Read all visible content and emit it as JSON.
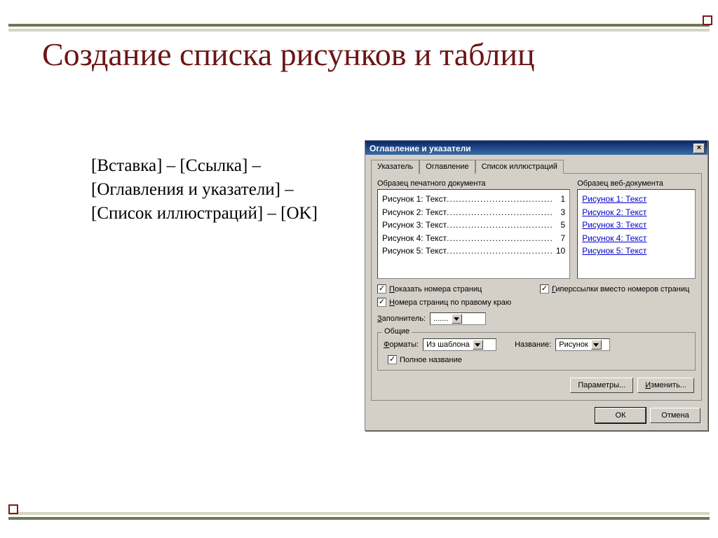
{
  "slide": {
    "title": "Создание списка рисунков и таблиц",
    "instructions": "[Вставка] – [Ссылка] – [Оглавления и указатели] – [Список иллюстраций] – [OK]"
  },
  "dialog": {
    "title": "Оглавление и указатели",
    "close": "×",
    "tabs": {
      "index": "Указатель",
      "toc": "Оглавление",
      "figures": "Список иллюстраций"
    },
    "printPreviewLabel": "Образец печатного документа",
    "webPreviewLabel": "Образец веб-документа",
    "printItems": [
      {
        "label": "Рисунок 1: Текст",
        "page": "1"
      },
      {
        "label": "Рисунок 2: Текст",
        "page": "3"
      },
      {
        "label": "Рисунок 3: Текст",
        "page": "5"
      },
      {
        "label": "Рисунок 4: Текст",
        "page": "7"
      },
      {
        "label": "Рисунок 5: Текст",
        "page": "10"
      }
    ],
    "webItems": [
      "Рисунок 1: Текст",
      "Рисунок 2: Текст",
      "Рисунок 3: Текст",
      "Рисунок 4: Текст",
      "Рисунок 5: Текст"
    ],
    "chkShowPages_pre": "П",
    "chkShowPages_rest": "оказать номера страниц",
    "chkRightAlign_pre": "Н",
    "chkRightAlign_rest": "омера страниц по правому краю",
    "chkHyperlinks_pre": "Г",
    "chkHyperlinks_rest": "иперссылки вместо номеров страниц",
    "leaderLabel_pre": "З",
    "leaderLabel_rest": "аполнитель:",
    "leaderValue": ".......",
    "groupGeneral": "Общие",
    "formatsLabel_pre": "Ф",
    "formatsLabel_rest": "орматы:",
    "formatsValue": "Из шаблона",
    "captionLabel": "Название:",
    "captionValue": "Рисунок",
    "fullCaption": "Полное название",
    "btnOptions": "Параметры...",
    "btnModify_pre": "И",
    "btnModify_rest": "зменить...",
    "btnOk": "ОК",
    "btnCancel": "Отмена"
  },
  "fill": "..................................."
}
